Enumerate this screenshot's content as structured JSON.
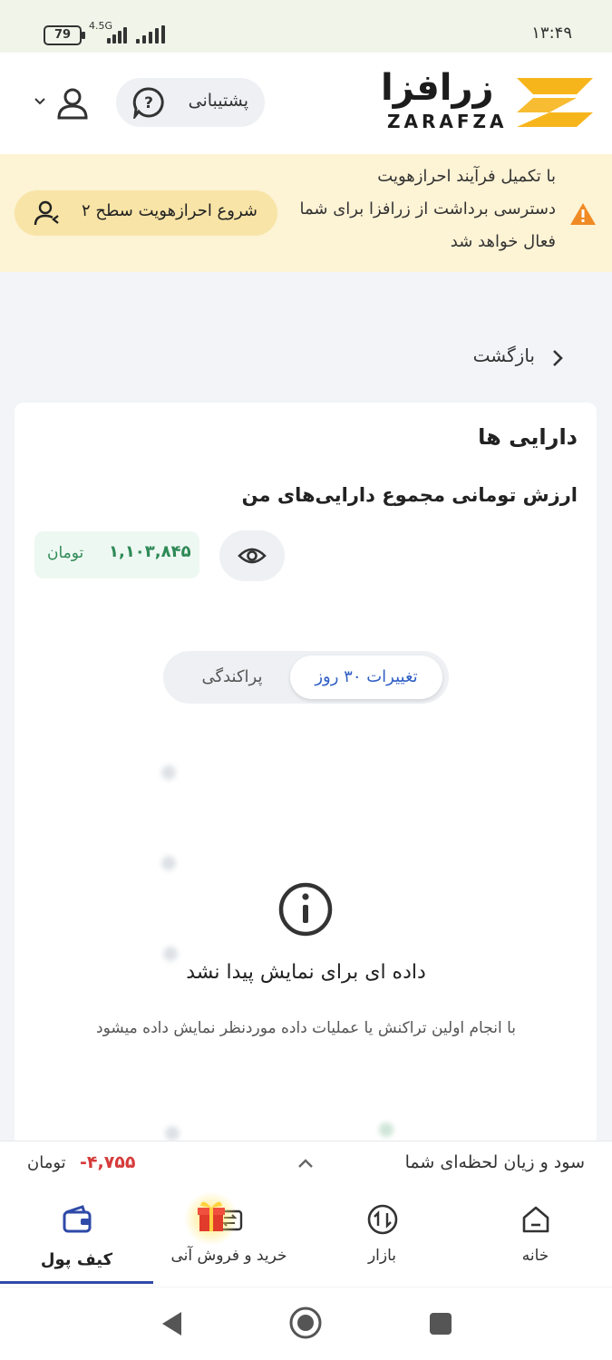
{
  "status_bar": {
    "battery": "79",
    "network": "4.5G",
    "time": "۱۳:۴۹"
  },
  "header": {
    "logo_fa": "زرافزا",
    "logo_en": "ZARAFZA",
    "support_label": "پشتیبانی",
    "brand_color": "#f7b51c"
  },
  "banner": {
    "line1": "با تکمیل فرآیند احرازهویت",
    "line2": "دسترسی برداشت از زرافزا برای شما",
    "line3": "فعال خواهد شد",
    "button_label": "شروع احرازهویت سطح ۲",
    "warning_color": "#f08a24"
  },
  "back": {
    "label": "بازگشت"
  },
  "assets": {
    "title": "دارایی ها",
    "value_title": "ارزش تومانی مجموع دارایی‌های من",
    "amount": "۱,۱۰۳,۸۴۵",
    "unit": "تومان"
  },
  "tabs": [
    {
      "label": "تغییرات ۳۰ روز",
      "active": true
    },
    {
      "label": "پراکندگی",
      "active": false
    }
  ],
  "empty_state": {
    "title": "داده ای برای نمایش پیدا نشد",
    "subtitle": "با انجام اولین تراکنش یا عملیات داده موردنظر نمایش داده میشود"
  },
  "pnl": {
    "label": "سود و زیان لحظه‌ای شما",
    "value": "-۴,۷۵۵",
    "unit": "تومان"
  },
  "nav": {
    "home": "خانه",
    "market": "بازار",
    "trade": "خرید و فروش آنی",
    "wallet": "کیف پول",
    "active": "wallet"
  }
}
